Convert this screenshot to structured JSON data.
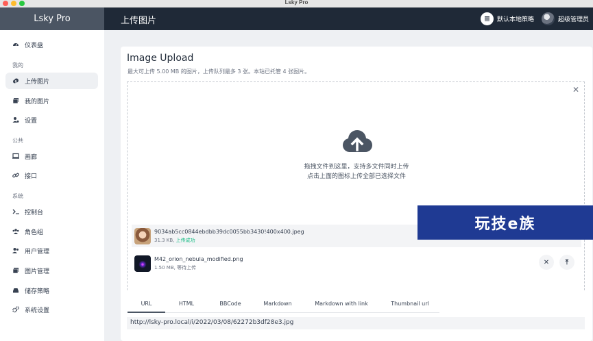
{
  "window": {
    "title": "Lsky Pro"
  },
  "brand": {
    "name": "Lsky Pro"
  },
  "header": {
    "page_title": "上传图片",
    "strategy_label": "默认本地策略",
    "user_label": "超级管理员"
  },
  "sidebar": {
    "groups": {
      "mine": "我的",
      "public": "公共",
      "system": "系统"
    },
    "items": [
      {
        "label": "仪表盘",
        "icon": "dashboard-icon"
      },
      {
        "label": "上传图片",
        "icon": "cloud-upload-icon"
      },
      {
        "label": "我的图片",
        "icon": "images-icon"
      },
      {
        "label": "设置",
        "icon": "user-cog-icon"
      },
      {
        "label": "画廊",
        "icon": "monitor-icon"
      },
      {
        "label": "接口",
        "icon": "link-icon"
      },
      {
        "label": "控制台",
        "icon": "terminal-icon"
      },
      {
        "label": "角色组",
        "icon": "users-icon"
      },
      {
        "label": "用户管理",
        "icon": "user-manage-icon"
      },
      {
        "label": "图片管理",
        "icon": "image-manage-icon"
      },
      {
        "label": "储存策略",
        "icon": "storage-icon"
      },
      {
        "label": "系统设置",
        "icon": "gears-icon"
      }
    ]
  },
  "upload": {
    "title": "Image Upload",
    "description": "最大可上传 5.00 MB 的图片，上传队列最多 3 张。本站已托管 4 张图片。",
    "hint_line1": "拖拽文件到这里，支持多文件同时上传",
    "hint_line2": "点击上面的图标上传全部已选择文件",
    "close": "✕",
    "files": [
      {
        "name": "9034ab5cc0844ebdbb39dc0055bb3430!400x400.jpeg",
        "size": "31.3 KB,",
        "status": "上传成功"
      },
      {
        "name": "M42_orion_nebula_modified.png",
        "size": "1.50 MB,",
        "status": "等待上传"
      }
    ],
    "remove_symbol": "✕",
    "upload_symbol": "⤒"
  },
  "watermark": {
    "text": "玩技e族"
  },
  "links": {
    "tabs": [
      "URL",
      "HTML",
      "BBCode",
      "Markdown",
      "Markdown with link",
      "Thumbnail url"
    ],
    "active_tab": "URL",
    "value": "http://lsky-pro.local/i/2022/03/08/62272b3df28e3.jpg"
  },
  "colors": {
    "topbar": "#1f2937",
    "brand": "#4b5563",
    "success": "#10b981",
    "watermark": "#1f3a93"
  }
}
